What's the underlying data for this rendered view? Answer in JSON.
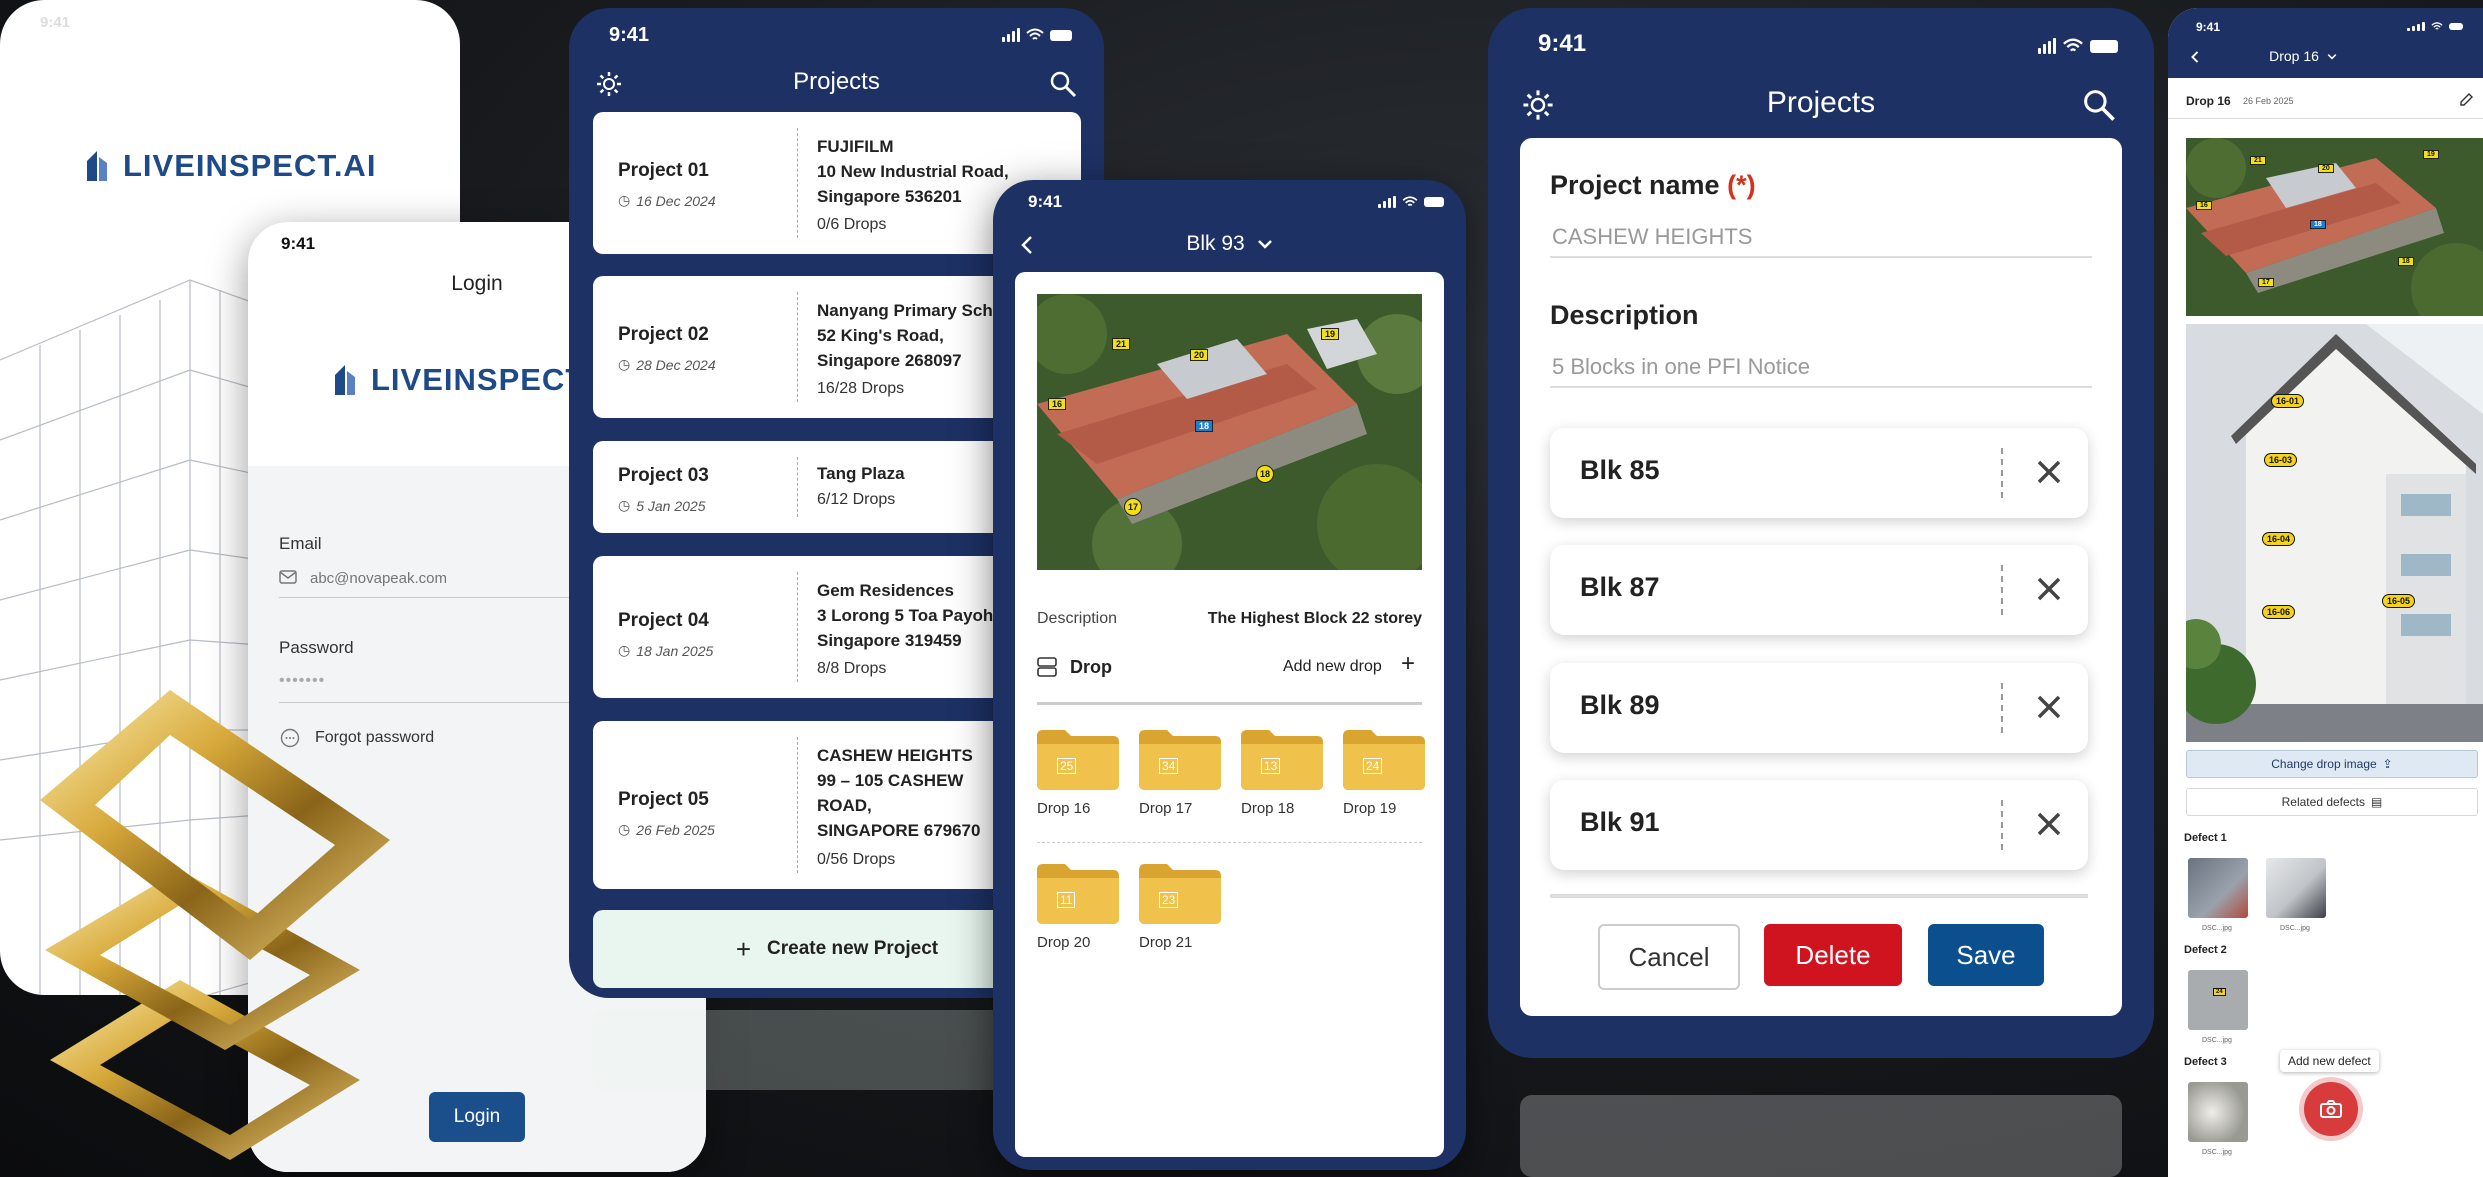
{
  "login_splash": {
    "time": "9:41",
    "logo": "LIVEINSPECT.AI"
  },
  "login": {
    "time": "9:41",
    "title": "Login",
    "logo": "LIVEINSPECT.AI",
    "email_label": "Email",
    "email_placeholder": "abc@novapeak.com",
    "password_label": "Password",
    "password_value": "•••••••",
    "forgot_password": "Forgot password",
    "login_button": "Login"
  },
  "projects": {
    "time": "9:41",
    "title": "Projects",
    "items": [
      {
        "name": "Project 01",
        "date": "16 Dec 2024",
        "client": "FUJIFILM",
        "address": [
          "10 New Industrial Road,",
          "Singapore 536201"
        ],
        "drops": "0/6 Drops"
      },
      {
        "name": "Project 02",
        "date": "28 Dec 2024",
        "client": "Nanyang Primary School",
        "address": [
          "52 King's Road,",
          "Singapore 268097"
        ],
        "drops": "16/28 Drops"
      },
      {
        "name": "Project 03",
        "date": "5 Jan 2025",
        "client": "Tang Plaza",
        "address": [],
        "drops": "6/12 Drops"
      },
      {
        "name": "Project 04",
        "date": "18 Jan 2025",
        "client": "Gem Residences",
        "address": [
          "3 Lorong 5 Toa Payoh,",
          "Singapore 319459"
        ],
        "drops": "8/8 Drops"
      },
      {
        "name": "Project 05",
        "date": "26 Feb 2025",
        "client": "CASHEW HEIGHTS",
        "address": [
          "99 – 105 CASHEW",
          "ROAD,",
          "SINGAPORE 679670"
        ],
        "drops": "0/56 Drops"
      }
    ],
    "create_button": "Create new Project"
  },
  "block": {
    "time": "9:41",
    "title": "Blk 93",
    "map_tags": [
      "21",
      "20",
      "19",
      "16",
      "18",
      "17",
      "18"
    ],
    "description_label": "Description",
    "description_value": "The Highest Block 22 storey",
    "drop_section": "Drop",
    "add_drop": "Add new drop",
    "drops": [
      {
        "label": "Drop 16",
        "count": "25"
      },
      {
        "label": "Drop 17",
        "count": "34"
      },
      {
        "label": "Drop 18",
        "count": "13"
      },
      {
        "label": "Drop 19",
        "count": "24"
      },
      {
        "label": "Drop 20",
        "count": "11"
      },
      {
        "label": "Drop 21",
        "count": "23"
      }
    ],
    "colors": {
      "folder": "#f0c14b",
      "folder_dark": "#d9a530"
    }
  },
  "project_edit": {
    "time": "9:41",
    "title": "Projects",
    "name_label": "Project name",
    "required_mark": "(*)",
    "name_value": "CASHEW HEIGHTS",
    "description_label": "Description",
    "description_value": "5 Blocks in one PFI Notice",
    "blocks": [
      "Blk 85",
      "Blk 87",
      "Blk 89",
      "Blk 91"
    ],
    "cancel": "Cancel",
    "delete": "Delete",
    "save": "Save",
    "colors": {
      "delete": "#d0141f",
      "save": "#0b4f8f",
      "required": "#d0341f"
    }
  },
  "drop_detail": {
    "time": "9:41",
    "title": "Drop 16",
    "subtitle": "Drop 16",
    "date": "26 Feb 2025",
    "photo_tags": [
      "16-01",
      "16-03",
      "16-04",
      "16-06",
      "16-05"
    ],
    "change_image": "Change drop image",
    "related_defects": "Related defects",
    "defects": [
      {
        "label": "Defect 1",
        "files": [
          "DSC...jpg",
          "DSC...jpg"
        ]
      },
      {
        "label": "Defect 2",
        "files": [
          "DSC...jpg"
        ]
      },
      {
        "label": "Defect 3",
        "files": [
          "DSC...jpg"
        ]
      }
    ],
    "add_defect_tooltip": "Add new defect",
    "colors": {
      "camera_button": "#d83b3b"
    }
  },
  "brand": {
    "navy": "#1e3165",
    "logo_blue": "#1f4a8a"
  }
}
